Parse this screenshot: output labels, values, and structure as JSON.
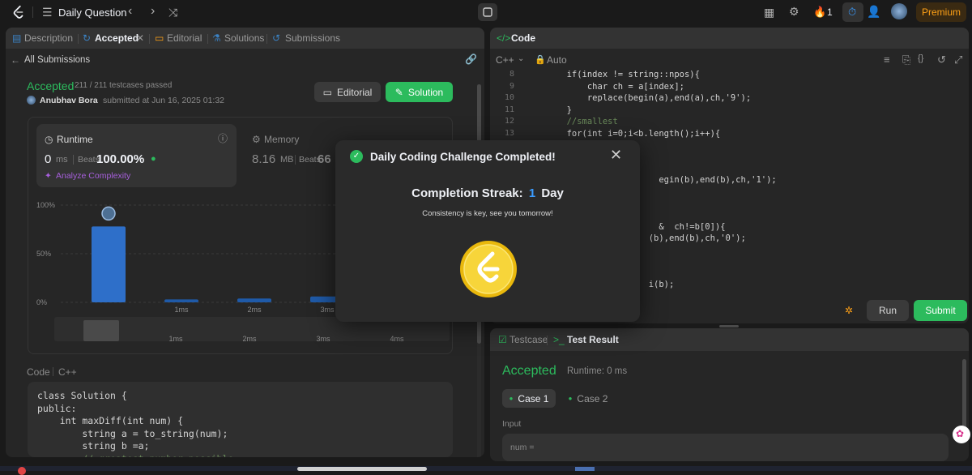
{
  "topnav": {
    "title": "Daily Question",
    "streak_count": "1",
    "premium_label": "Premium"
  },
  "left_panel": {
    "tabs": [
      {
        "label": "Description"
      },
      {
        "label": "Accepted"
      },
      {
        "label": "Editorial"
      },
      {
        "label": "Solutions"
      },
      {
        "label": "Submissions"
      }
    ],
    "back_label": "All Submissions",
    "status": "Accepted",
    "testcases": "211 / 211 testcases passed",
    "user": "Anubhav Bora",
    "submitted_text": "submitted at Jun 16, 2025 01:32",
    "editorial_button": "Editorial",
    "solution_button": "Solution",
    "runtime": {
      "label": "Runtime",
      "value": "0",
      "unit": "ms",
      "beats_label": "Beats",
      "beats_value": "100.00%",
      "analyze": "Analyze Complexity"
    },
    "memory": {
      "label": "Memory",
      "value": "8.16",
      "unit": "MB",
      "beats_label": "Beats",
      "beats_value": "66"
    },
    "code_header": {
      "label": "Code",
      "lang": "C++"
    },
    "code_lines": [
      "class Solution {",
      "public:",
      "    int maxDiff(int num) {",
      "        string a = to_string(num);",
      "        string b =a;",
      "        // greatest number possible"
    ]
  },
  "chart_data": {
    "type": "bar",
    "y_ticks": [
      "100%",
      "50%",
      "0%"
    ],
    "x_labels": [
      "1ms",
      "2ms",
      "3ms"
    ],
    "mini_x_labels": [
      "1ms",
      "2ms",
      "3ms",
      "4ms"
    ],
    "categories": [
      "0ms",
      "1ms",
      "2ms",
      "3ms"
    ],
    "values": [
      78,
      3,
      4,
      6
    ],
    "ylim": [
      0,
      100
    ],
    "highlight_color": "#2e6fc9"
  },
  "editor": {
    "title": "Code",
    "lang": "C++",
    "mode": "Auto",
    "lines": [
      {
        "n": "8",
        "t": "        if(index != string::npos){"
      },
      {
        "n": "9",
        "t": "            char ch = a[index];"
      },
      {
        "n": "10",
        "t": "            replace(begin(a),end(a),ch,'9');"
      },
      {
        "n": "11",
        "t": "        }"
      },
      {
        "n": "12",
        "t": "        //smallest"
      },
      {
        "n": "13",
        "t": "        for(int i=0;i<b.length();i++){"
      },
      {
        "n": "",
        "t": "                          egin(b),end(b),ch,'1');"
      },
      {
        "n": "",
        "t": "                          &  ch!=b[0]){"
      },
      {
        "n": "",
        "t": "                        (b),end(b),ch,'0');"
      },
      {
        "n": "",
        "t": "                        i(b);"
      }
    ],
    "run_label": "Run",
    "submit_label": "Submit"
  },
  "result_panel": {
    "tab_testcase": "Testcase",
    "tab_result": "Test Result",
    "status": "Accepted",
    "runtime": "Runtime: 0 ms",
    "case1": "Case 1",
    "case2": "Case 2",
    "input_label": "Input",
    "input_value": "num ="
  },
  "modal": {
    "title": "Daily Coding Challenge Completed!",
    "streak_label": "Completion Streak:",
    "streak_value": "1",
    "streak_unit": "Day",
    "subtitle": "Consistency is key, see you tomorrow!"
  }
}
